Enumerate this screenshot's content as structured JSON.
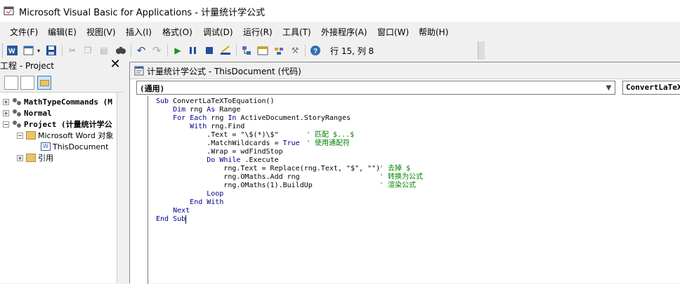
{
  "window": {
    "title": "Microsoft Visual Basic for Applications - 计量统计学公式"
  },
  "menu": [
    "文件(F)",
    "编辑(E)",
    "视图(V)",
    "插入(I)",
    "格式(O)",
    "调试(D)",
    "运行(R)",
    "工具(T)",
    "外接程序(A)",
    "窗口(W)",
    "帮助(H)"
  ],
  "status": {
    "position": "行 15, 列 8"
  },
  "project_panel": {
    "title": "工程 - Project",
    "close": "✕",
    "tree": [
      {
        "label": "MathTypeCommands (M",
        "bold": true
      },
      {
        "label": "Normal",
        "bold": true
      },
      {
        "label": "Project (计量统计学公",
        "bold": true
      },
      {
        "label": "Microsoft Word 对象"
      },
      {
        "label": "ThisDocument"
      },
      {
        "label": "引用"
      }
    ]
  },
  "code_window": {
    "title": "计量统计学公式 - ThisDocument (代码)",
    "object_combo": "(通用)",
    "proc_combo": "ConvertLaTeXToEquation",
    "lines": [
      "Sub ConvertLaTeXToEquation()",
      "    Dim rng As Range",
      "    For Each rng In ActiveDocument.StoryRanges",
      "        With rng.Find",
      "            .Text = \"\\$(*)\\$\"",
      "            .MatchWildcards = True",
      "            .Wrap = wdFindStop",
      "            Do While .Execute",
      "                rng.Text = Replace(rng.Text, \"$\", \"\")",
      "                rng.OMaths.Add rng",
      "                rng.OMaths(1).BuildUp",
      "            Loop",
      "        End With",
      "    Next",
      "End Sub"
    ],
    "comments": [
      {
        "line": 4,
        "text": "' 匹配 $...$"
      },
      {
        "line": 5,
        "text": "' 使用通配符"
      },
      {
        "line": 8,
        "text": "' 去掉 $"
      },
      {
        "line": 9,
        "text": "' 转换为公式"
      },
      {
        "line": 10,
        "text": "' 渲染公式"
      }
    ]
  },
  "colors": {
    "keyword": "#00008b",
    "comment": "#008000"
  }
}
